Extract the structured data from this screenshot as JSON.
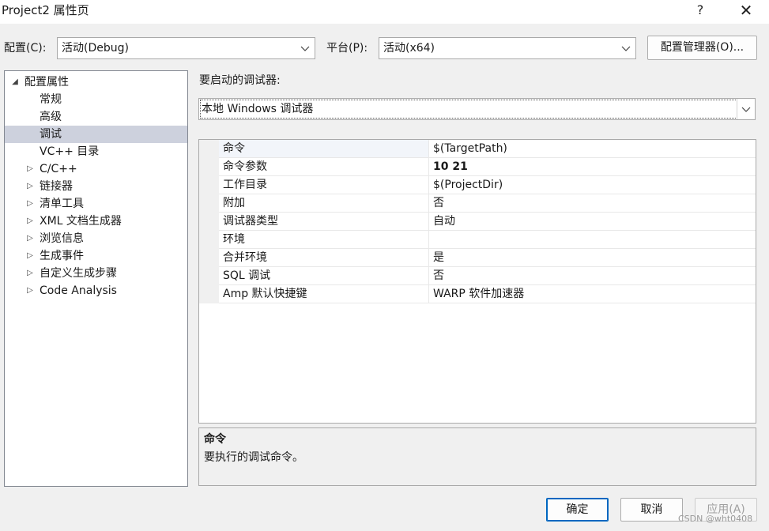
{
  "window": {
    "title": "Project2 属性页",
    "help_label": "?",
    "close_label": "✕"
  },
  "toolbar": {
    "config_label": "配置(C):",
    "config_value": "活动(Debug)",
    "platform_label": "平台(P):",
    "platform_value": "活动(x64)",
    "config_manager_label": "配置管理器(O)..."
  },
  "tree": {
    "items": [
      {
        "label": "配置属性",
        "arrow": "◢"
      },
      {
        "label": "常规",
        "arrow": ""
      },
      {
        "label": "高级",
        "arrow": ""
      },
      {
        "label": "调试",
        "arrow": ""
      },
      {
        "label": "VC++ 目录",
        "arrow": ""
      },
      {
        "label": "C/C++",
        "arrow": "▷"
      },
      {
        "label": "链接器",
        "arrow": "▷"
      },
      {
        "label": "清单工具",
        "arrow": "▷"
      },
      {
        "label": "XML 文档生成器",
        "arrow": "▷"
      },
      {
        "label": "浏览信息",
        "arrow": "▷"
      },
      {
        "label": "生成事件",
        "arrow": "▷"
      },
      {
        "label": "自定义生成步骤",
        "arrow": "▷"
      },
      {
        "label": "Code Analysis",
        "arrow": "▷"
      }
    ],
    "selected": "调试"
  },
  "debugger": {
    "label": "要启动的调试器:",
    "value": "本地 Windows 调试器"
  },
  "properties": {
    "rows": [
      {
        "name": "命令",
        "value": "$(TargetPath)"
      },
      {
        "name": "命令参数",
        "value": "10 21"
      },
      {
        "name": "工作目录",
        "value": "$(ProjectDir)"
      },
      {
        "name": "附加",
        "value": "否"
      },
      {
        "name": "调试器类型",
        "value": "自动"
      },
      {
        "name": "环境",
        "value": ""
      },
      {
        "name": "合并环境",
        "value": "是"
      },
      {
        "name": "SQL 调试",
        "value": "否"
      },
      {
        "name": "Amp 默认快捷键",
        "value": "WARP 软件加速器"
      }
    ]
  },
  "description": {
    "title": "命令",
    "text": "要执行的调试命令。"
  },
  "buttons": {
    "ok": "确定",
    "cancel": "取消",
    "apply": "应用(A)"
  },
  "watermark": "CSDN @wht0408",
  "colors": {
    "selection": "#cdd1dd",
    "ok_border": "#0067c0",
    "background": "#f0f0f0"
  }
}
